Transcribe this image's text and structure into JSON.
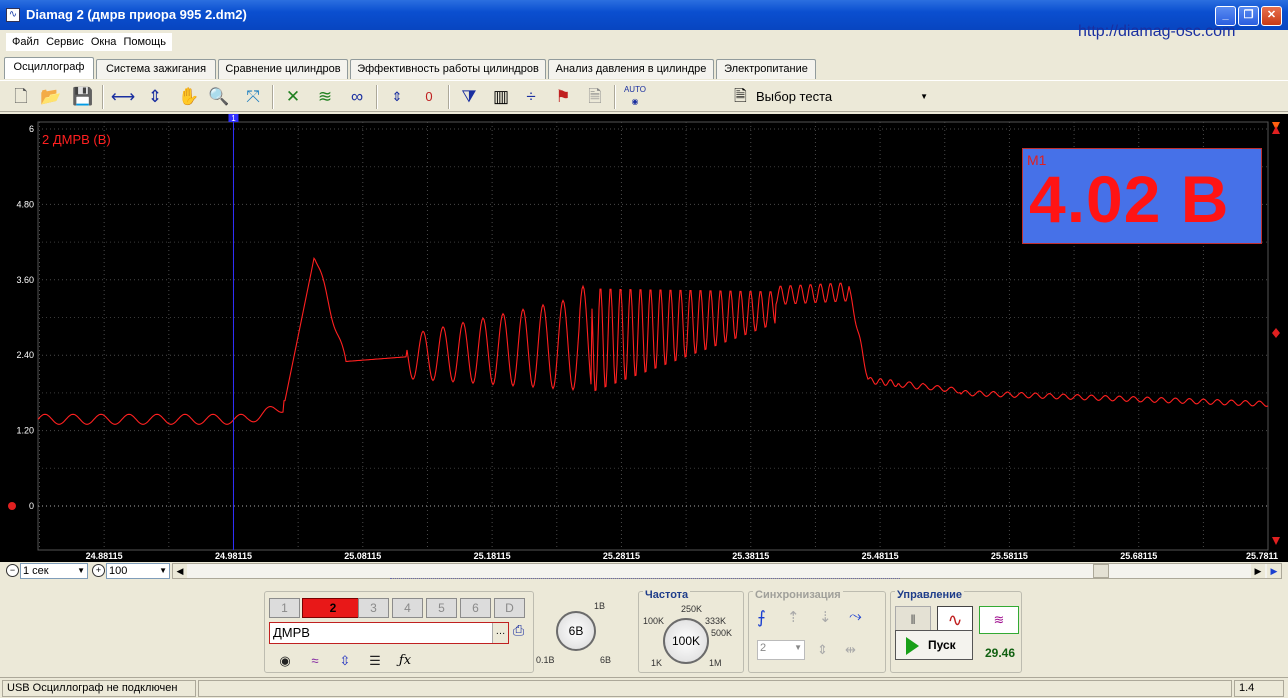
{
  "window": {
    "title": "Diamag 2 (дмрв приора 995 2.dm2)",
    "url": "http://diamag-osc.com"
  },
  "menu": [
    "Файл",
    "Сервис",
    "Окна",
    "Помощь"
  ],
  "tabs": [
    "Осциллограф",
    "Система зажигания",
    "Сравнение цилиндров",
    "Эффективность работы цилиндров",
    "Анализ давления в цилиндре",
    "Электропитание"
  ],
  "toolbar": {
    "test_select": "Выбор теста",
    "zero_label": "0",
    "auto_label": "AUTO"
  },
  "scope": {
    "channel_label": "2 ДМРВ (В)",
    "marker_label": "M1",
    "marker_value": "4.02 В",
    "cursor_tag": "1",
    "y_ticks": [
      "6",
      "4.80",
      "3.60",
      "2.40",
      "1.20",
      "0"
    ],
    "x_ticks": [
      "24.88115",
      "24.98115",
      "25.08115",
      "25.18115",
      "25.28115",
      "25.38115",
      "25.48115",
      "25.58115",
      "25.68115",
      "25.7811"
    ],
    "colors": {
      "trace": "#ff2020",
      "cursor": "#3030ff",
      "background": "#000000",
      "marker_box": "#4671e8"
    }
  },
  "chart_data": {
    "type": "line",
    "title": "",
    "series": [
      {
        "name": "2 ДМРВ (В)",
        "x_start": 24.83,
        "x_end": 25.7811,
        "approx_y": [
          1.4,
          1.5,
          1.3,
          1.5,
          1.3,
          1.4,
          4.0,
          2.3,
          2.6,
          2.1,
          2.7,
          1.8,
          2.9,
          1.6,
          3.3,
          1.5,
          3.5,
          2.2,
          3.5,
          3.4,
          3.6,
          3.3,
          2.0,
          1.9,
          1.75,
          1.7,
          1.65,
          1.6
        ]
      }
    ],
    "ylim": [
      0,
      6
    ],
    "xlim": [
      24.83,
      25.7811
    ],
    "y_ticks": [
      0,
      1.2,
      2.4,
      3.6,
      4.8,
      6
    ],
    "cursor_x": 24.98115,
    "cursor_value": 4.02,
    "grid": true
  },
  "hscroll": {
    "timebase": "1 сек",
    "zoom": "100"
  },
  "channels": {
    "buttons": [
      "1",
      "2",
      "3",
      "4",
      "5",
      "6",
      "D"
    ],
    "active": "2",
    "name": "ДМРВ"
  },
  "range_knob": {
    "value": "6В",
    "marks": [
      "1В",
      "0.1В",
      "6В"
    ]
  },
  "frequency": {
    "title": "Частота",
    "value": "100K",
    "marks": [
      "250K",
      "100K",
      "333K",
      "500K",
      "1K",
      "1M"
    ]
  },
  "sync": {
    "title": "Синхронизация",
    "channel": "2"
  },
  "control": {
    "title": "Управление",
    "start_label": "Пуск",
    "timer": "29.46"
  },
  "status": {
    "message": "USB Осциллограф не подключен",
    "version": "1.4"
  }
}
